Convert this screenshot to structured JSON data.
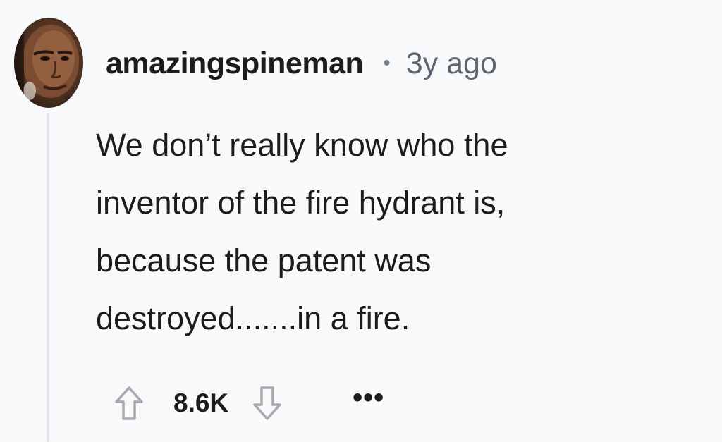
{
  "comment": {
    "username": "amazingspineman",
    "separator": "•",
    "timestamp": "3y ago",
    "body_lines": [
      "We don’t really know who the",
      "inventor of the fire hydrant is,",
      "because the patent was",
      "destroyed.......in a fire."
    ]
  },
  "actions": {
    "upvote_icon": "upvote-arrow-icon",
    "score": "8.6K",
    "downvote_icon": "downvote-arrow-icon",
    "more_label": "•••"
  },
  "colors": {
    "background": "#f8f9fb",
    "text": "#1c1c1c",
    "meta": "#5f6570",
    "thread_line": "#e4e6ea",
    "icon_stroke": "#a7a9ad"
  }
}
